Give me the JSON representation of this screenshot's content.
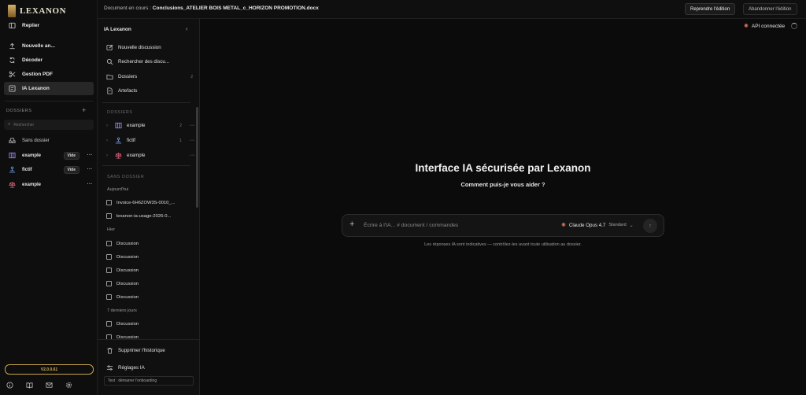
{
  "brand": {
    "name": "LEXANON"
  },
  "sidebar": {
    "items": [
      {
        "label": "Replier",
        "icon": "sidebar-toggle-icon"
      },
      {
        "label": "Nouvelle an...",
        "icon": "upload-icon"
      },
      {
        "label": "Décoder",
        "icon": "refresh-icon"
      },
      {
        "label": "Gestion PDF",
        "icon": "scissors-icon"
      },
      {
        "label": "IA Lexanon",
        "icon": "chat-square-icon"
      }
    ],
    "folders_title": "DOSSIERS",
    "add_label": "+",
    "search_placeholder": "Rechercher",
    "folders": [
      {
        "label": "Sans dossier",
        "icon": "inbox-icon"
      },
      {
        "label": "example",
        "icon": "columns-icon",
        "badge": "Vide"
      },
      {
        "label": "fictif",
        "icon": "person-desk-icon",
        "badge": "Vide"
      },
      {
        "label": "example",
        "icon": "scale-icon"
      }
    ],
    "version": "V2.0.0.61"
  },
  "topbar": {
    "doc_prefix": "Document en cours :",
    "doc_name": "Conclusions_ATELIER BOIS METAL_c_HORIZON PROMOTION.docx",
    "resume_label": "Reprendre l'édition",
    "abandon_label": "Abandonner l'édition"
  },
  "panel": {
    "title": "IA Lexanon",
    "collapse": "‹",
    "actions": [
      {
        "label": "Nouvelle discussion",
        "icon": "edit-icon"
      },
      {
        "label": "Rechercher des discu...",
        "icon": "search-icon"
      },
      {
        "label": "Dossiers",
        "icon": "folder-icon",
        "count": "2"
      },
      {
        "label": "Artefacts",
        "icon": "file-icon"
      }
    ],
    "folders_title": "DOSSIERS",
    "folders": [
      {
        "label": "example",
        "icon": "columns-icon",
        "count": "2"
      },
      {
        "label": "fictif",
        "icon": "person-desk-icon",
        "count": "1"
      },
      {
        "label": "example",
        "icon": "scale-icon",
        "count": ""
      }
    ],
    "no_folder_title": "SANS DOSSIER",
    "groups": {
      "today": "Aujourd'hui",
      "yesterday": "Hier",
      "last7": "7 derniers jours"
    },
    "today_items": [
      "Invoice-6H6ZOW3S-0010_...",
      "lexanon-ia-usage-2026-0..."
    ],
    "yesterday_items": [
      "Discussion",
      "Discussion",
      "Discussion",
      "Discussion",
      "Discussion"
    ],
    "last7_items": [
      "Discussion",
      "Discussion"
    ],
    "clear_history": "Supprimer l'historique",
    "settings": "Réglages IA",
    "test_label": "Test : démarrer l'onboarding"
  },
  "main": {
    "api_status": "API connectée",
    "title": "Interface IA sécurisée par Lexanon",
    "subtitle": "Comment puis-je vous aider ?",
    "composer": {
      "plus": "+",
      "placeholder": "Écrire à l'IA...   # document   / commandes",
      "model": "Claude Opus 4.7",
      "tier": "Standard",
      "send": "↑"
    },
    "disclaimer": "Les réponses IA sont indicatives — contrôlez-les avant toute utilisation au dossier."
  },
  "colors": {
    "accent_gold": "#c9a54d",
    "claude_orange": "#d97757"
  }
}
